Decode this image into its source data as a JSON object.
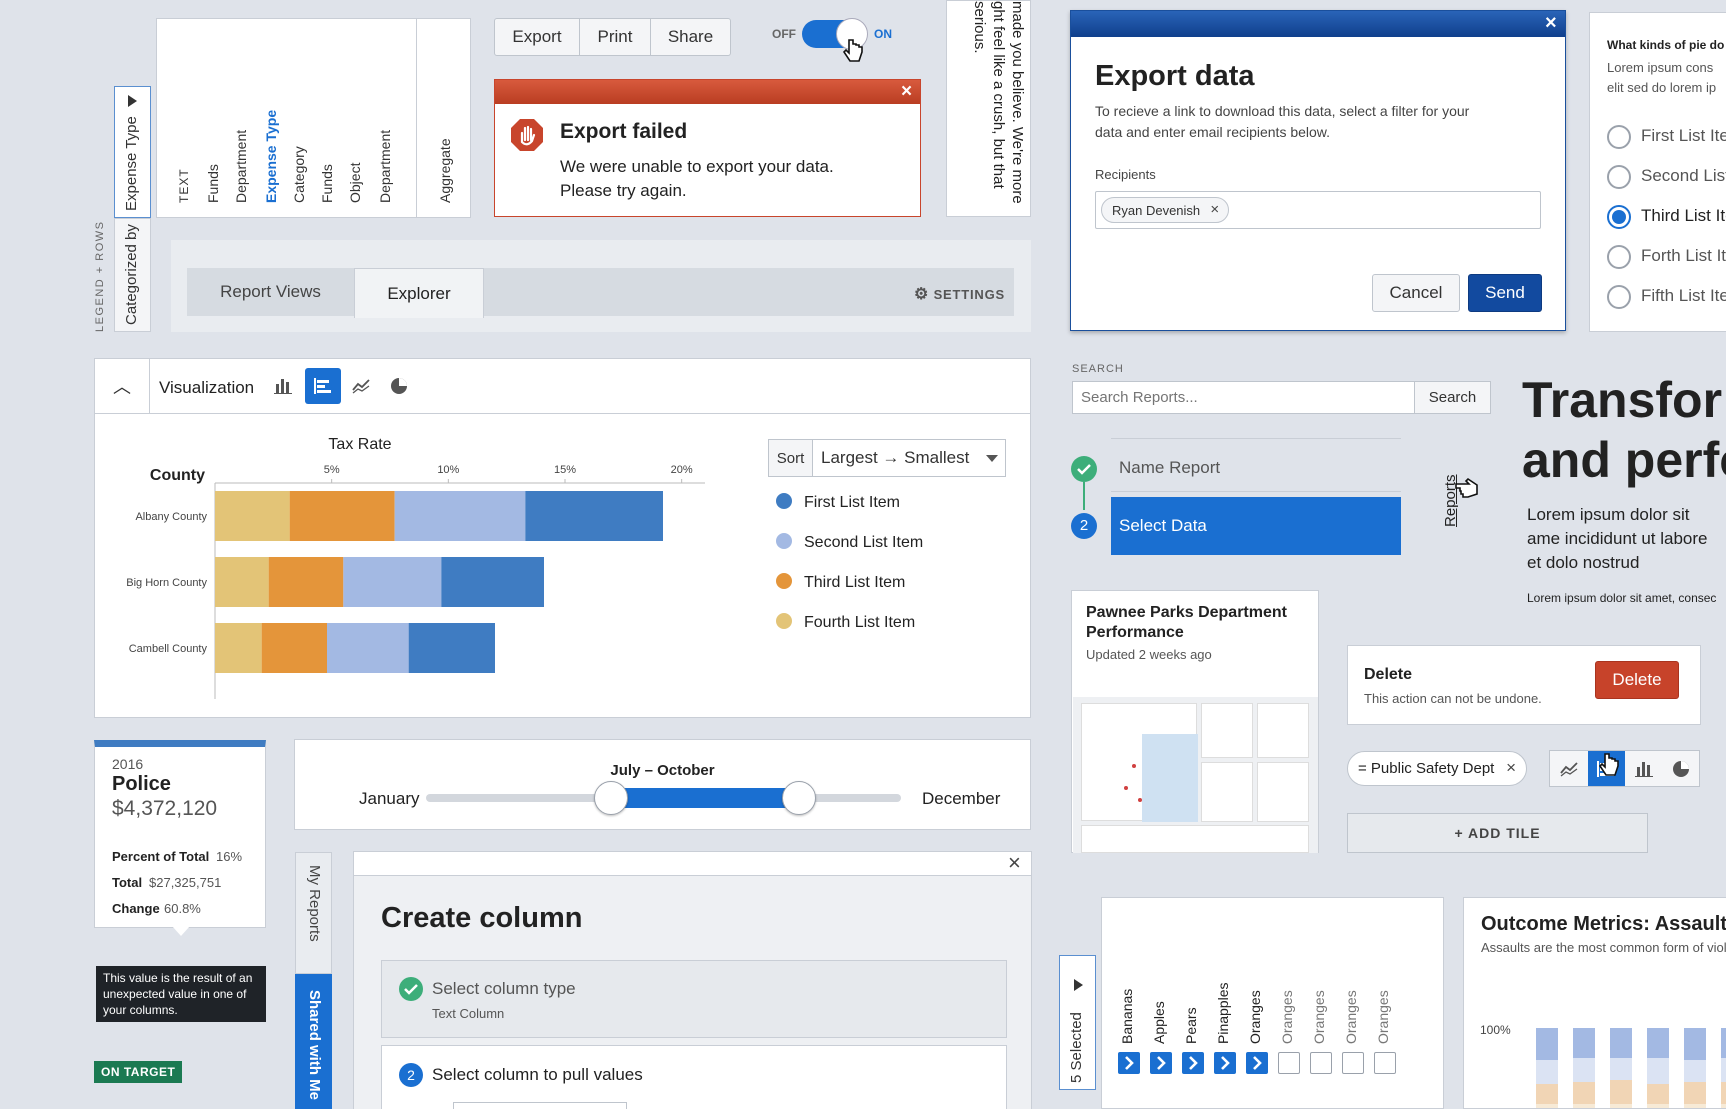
{
  "header_filter": {
    "legend_rows_label": "LEGEND + ROWS",
    "tab_expense_type": "Expense Type",
    "tab_categorized_by": "Categorized by",
    "columns": [
      "TEXT",
      "Funds",
      "Department",
      "Expense Type",
      "Category",
      "Funds",
      "Object",
      "Department"
    ],
    "aggregate_label": "Aggregate",
    "active_column_color": "#1a6fd1"
  },
  "toolbar": {
    "export": "Export",
    "print": "Print",
    "share": "Share"
  },
  "toggle": {
    "off": "OFF",
    "on": "ON"
  },
  "alert": {
    "title": "Export failed",
    "message": "We were unable to export your data. Please try again."
  },
  "side_text": {
    "line1": "made you believe. We're more",
    "line2": "ght feel like a crush, but that",
    "line3": "serious."
  },
  "tabs": {
    "report_views": "Report Views",
    "explorer": "Explorer",
    "settings": "SETTINGS"
  },
  "viz": {
    "title": "Visualization"
  },
  "sort": {
    "label": "Sort",
    "value": "Largest → Smallest"
  },
  "legend": [
    {
      "label": "First List Item",
      "color": "#3f7cc2"
    },
    {
      "label": "Second List Item",
      "color": "#a3b9e3"
    },
    {
      "label": "Third List Item",
      "color": "#e4953a"
    },
    {
      "label": "Fourth List Item",
      "color": "#e3c477"
    }
  ],
  "chart_data": {
    "type": "bar",
    "orientation": "horizontal",
    "stacked": true,
    "title": "Tax Rate",
    "ylabel": "County",
    "categories": [
      "Albany County",
      "Big Horn County",
      "Cambell County"
    ],
    "xticks": [
      "5%",
      "10%",
      "15%",
      "20%"
    ],
    "xlim": [
      0,
      21
    ],
    "series": [
      {
        "name": "Fourth List Item",
        "color": "#e3c477",
        "values": [
          3.2,
          2.3,
          2.0
        ]
      },
      {
        "name": "Third List Item",
        "color": "#e4953a",
        "values": [
          4.5,
          3.2,
          2.8
        ]
      },
      {
        "name": "Second List Item",
        "color": "#a3b9e3",
        "values": [
          5.6,
          4.2,
          3.5
        ]
      },
      {
        "name": "First List Item",
        "color": "#3f7cc2",
        "values": [
          5.9,
          4.4,
          3.7
        ]
      }
    ]
  },
  "stat_card": {
    "year": "2016",
    "title": "Police",
    "amount": "$4,372,120",
    "pct_label": "Percent of Total",
    "pct_value": "16%",
    "total_label": "Total",
    "total_value": "$27,325,751",
    "change_label": "Change",
    "change_value": "60.8%"
  },
  "tooltip": {
    "text": "This value is the result of an unexpected value in one of your columns."
  },
  "badge": {
    "text": "ON TARGET"
  },
  "range_slider": {
    "selection": "July – October",
    "min_label": "January",
    "max_label": "December",
    "start_fraction": 0.39,
    "end_fraction": 0.785
  },
  "vertical_tabs": {
    "my_reports": "My Reports",
    "shared": "Shared with Me"
  },
  "create_column": {
    "title": "Create column",
    "step1_title": "Select column type",
    "step1_sub": "Text Column",
    "step2_num": "2",
    "step2_title": "Select column to pull values"
  },
  "export_dialog": {
    "title": "Export data",
    "description": "To recieve a link to download this data, select a filter for your data and enter email recipients below.",
    "recipients_label": "Recipients",
    "recipient_chip": "Ryan Devenish",
    "cancel": "Cancel",
    "send": "Send"
  },
  "radio_panel": {
    "question": "What kinds of pie do",
    "body": "Lorem ipsum cons elit sed do lorem ip",
    "items": [
      "First List Ite",
      "Second List",
      "Third List Ite",
      "Forth List Ite",
      "Fifth List Ite"
    ],
    "selected_index": 2
  },
  "search": {
    "label": "SEARCH",
    "placeholder": "Search Reports...",
    "button": "Search"
  },
  "stepper": {
    "step1": "Name Report",
    "step2_num": "2",
    "step2": "Select Data"
  },
  "rotated_link": {
    "text": "Reports"
  },
  "hero": {
    "line1": "Transfor",
    "line2": "and perfo",
    "para": "Lorem ipsum dolor sit ame incididunt ut labore et dolo nostrud exercitation ullame",
    "small": "Lorem ipsum dolor sit amet, consec"
  },
  "report_card": {
    "title": "Pawnee Parks Department Performance",
    "updated": "Updated 2 weeks ago"
  },
  "delete_panel": {
    "title": "Delete",
    "message": "This action can not be undone.",
    "button": "Delete"
  },
  "filter_chip": {
    "text": "= Public Safety Dept"
  },
  "add_tile": {
    "text": "+ ADD TILE"
  },
  "selected_list": {
    "selected_label": "5 Selected",
    "items": [
      "Bananas",
      "Apples",
      "Pears",
      "Pinapples",
      "Oranges",
      "Oranges",
      "Oranges",
      "Oranges",
      "Oranges"
    ],
    "checked": [
      true,
      true,
      true,
      true,
      true,
      false,
      false,
      false,
      false
    ]
  },
  "outcome": {
    "title": "Outcome Metrics: Assault",
    "subtitle": "Assaults are the most common form of violen",
    "y_tick": "100%"
  }
}
